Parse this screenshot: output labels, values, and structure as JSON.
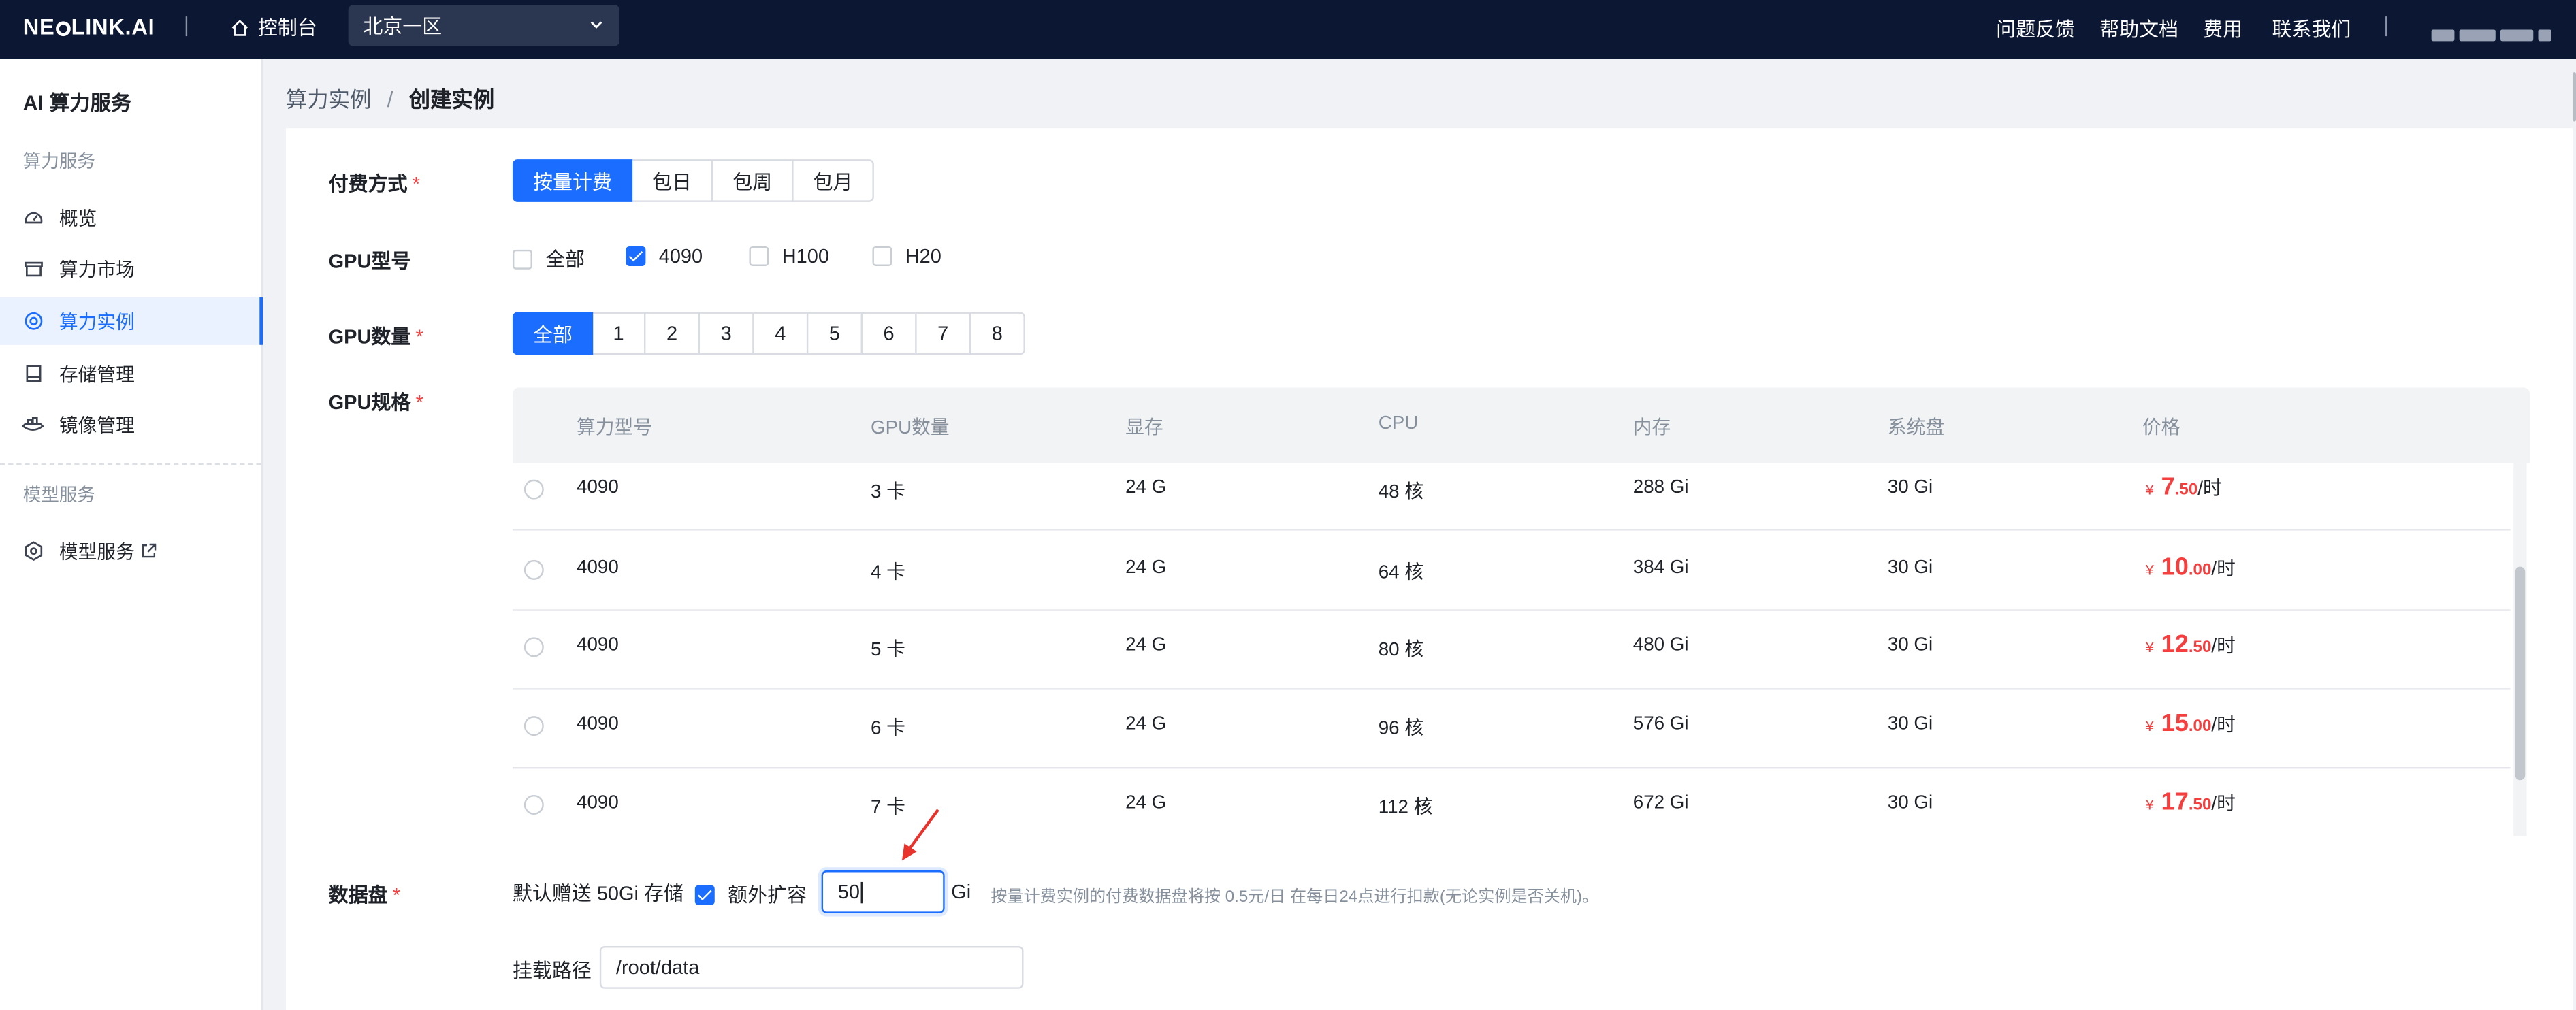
{
  "topbar": {
    "logo_pre": "NE",
    "logo_post": "LINK.AI",
    "console_label": "控制台",
    "region": "北京一区",
    "links": [
      "问题反馈",
      "帮助文档",
      "费用",
      "联系我们"
    ]
  },
  "sidebar": {
    "title": "AI 算力服务",
    "group1": "算力服务",
    "items": [
      {
        "label": "概览",
        "icon": "dashboard-icon"
      },
      {
        "label": "算力市场",
        "icon": "market-icon"
      },
      {
        "label": "算力实例",
        "icon": "instance-icon"
      },
      {
        "label": "存储管理",
        "icon": "storage-icon"
      },
      {
        "label": "镜像管理",
        "icon": "image-icon"
      }
    ],
    "group2": "模型服务",
    "model_item": {
      "label": "模型服务",
      "icon": "model-icon"
    }
  },
  "breadcrumb": {
    "parent": "算力实例",
    "separator": "/",
    "current": "创建实例"
  },
  "form": {
    "billing": {
      "label": "付费方式",
      "options": [
        "按量计费",
        "包日",
        "包周",
        "包月"
      ],
      "selected": "按量计费"
    },
    "gpu_model": {
      "label": "GPU型号",
      "options": [
        {
          "label": "全部",
          "checked": false
        },
        {
          "label": "4090",
          "checked": true
        },
        {
          "label": "H100",
          "checked": false
        },
        {
          "label": "H20",
          "checked": false
        }
      ]
    },
    "gpu_count": {
      "label": "GPU数量",
      "options": [
        "全部",
        "1",
        "2",
        "3",
        "4",
        "5",
        "6",
        "7",
        "8"
      ],
      "selected": "全部"
    },
    "gpu_spec": {
      "label": "GPU规格",
      "columns": [
        "算力型号",
        "GPU数量",
        "显存",
        "CPU",
        "内存",
        "系统盘",
        "价格"
      ],
      "rows": [
        {
          "model": "4090",
          "gpus": "3 卡",
          "vram": "24 G",
          "cpu": "48 核",
          "mem": "288 Gi",
          "disk": "30 Gi",
          "currency": "¥",
          "price_int": "7",
          "price_dec": ".50",
          "unit": "/时"
        },
        {
          "model": "4090",
          "gpus": "4 卡",
          "vram": "24 G",
          "cpu": "64 核",
          "mem": "384 Gi",
          "disk": "30 Gi",
          "currency": "¥",
          "price_int": "10",
          "price_dec": ".00",
          "unit": "/时"
        },
        {
          "model": "4090",
          "gpus": "5 卡",
          "vram": "24 G",
          "cpu": "80 核",
          "mem": "480 Gi",
          "disk": "30 Gi",
          "currency": "¥",
          "price_int": "12",
          "price_dec": ".50",
          "unit": "/时"
        },
        {
          "model": "4090",
          "gpus": "6 卡",
          "vram": "24 G",
          "cpu": "96 核",
          "mem": "576 Gi",
          "disk": "30 Gi",
          "currency": "¥",
          "price_int": "15",
          "price_dec": ".00",
          "unit": "/时"
        },
        {
          "model": "4090",
          "gpus": "7 卡",
          "vram": "24 G",
          "cpu": "112 核",
          "mem": "672 Gi",
          "disk": "30 Gi",
          "currency": "¥",
          "price_int": "17",
          "price_dec": ".50",
          "unit": "/时"
        }
      ]
    },
    "data_disk": {
      "label": "数据盘",
      "default_text": "默认赠送 50Gi 存储",
      "extra_label": "额外扩容",
      "extra_checked": true,
      "size_value": "50",
      "unit": "Gi",
      "note": "按量计费实例的付费数据盘将按 0.5元/日 在每日24点进行扣款(无论实例是否关机)。"
    },
    "mount": {
      "label": "挂载路径",
      "value": "/root/data"
    }
  },
  "colors": {
    "accent": "#1a6dff",
    "price": "#f53f3f",
    "topbar": "#0b1733",
    "arrow": "#e8322b"
  }
}
